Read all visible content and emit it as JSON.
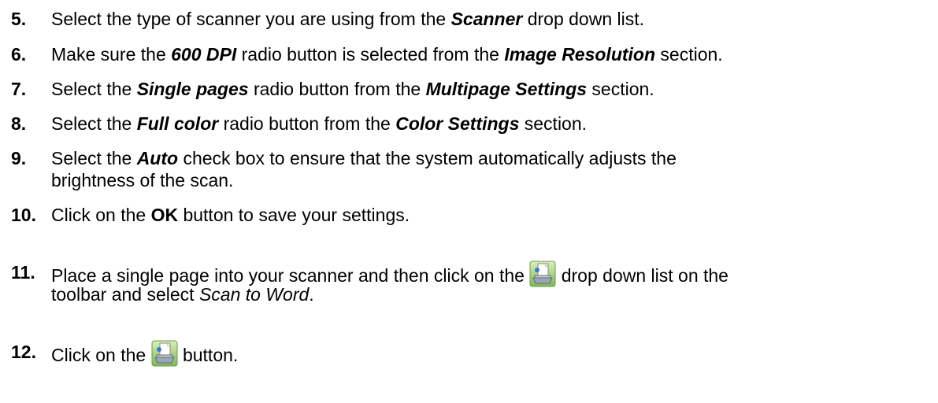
{
  "steps": [
    {
      "num": "5.",
      "parts": [
        "Select the type of scanner you are using from the ",
        "Scanner",
        " drop down list."
      ]
    },
    {
      "num": "6.",
      "parts": [
        "Make sure the ",
        "600 DPI",
        " radio button is selected from the ",
        "Image Resolution",
        " section."
      ]
    },
    {
      "num": "7.",
      "parts": [
        "Select the ",
        "Single pages",
        " radio button from the ",
        "Multipage Settings",
        " section."
      ]
    },
    {
      "num": "8.",
      "parts": [
        "Select the ",
        "Full color",
        " radio button from the ",
        "Color Settings",
        " section."
      ]
    },
    {
      "num": "9.",
      "parts": [
        "Select the ",
        "Auto",
        " check box to ensure that the system automatically adjusts the",
        "brightness of the scan."
      ]
    },
    {
      "num": "10.",
      "parts": [
        "Click on the ",
        "OK",
        " button to save your settings."
      ]
    },
    {
      "num": "11.",
      "parts": [
        "Place a single page into your scanner and then click on the ",
        " drop down list on the",
        "toolbar and select ",
        "Scan to Word",
        "."
      ]
    },
    {
      "num": "12.",
      "parts": [
        "Click on the ",
        " button."
      ]
    }
  ],
  "icons": {
    "scan_button": "scan-to-word-icon"
  }
}
